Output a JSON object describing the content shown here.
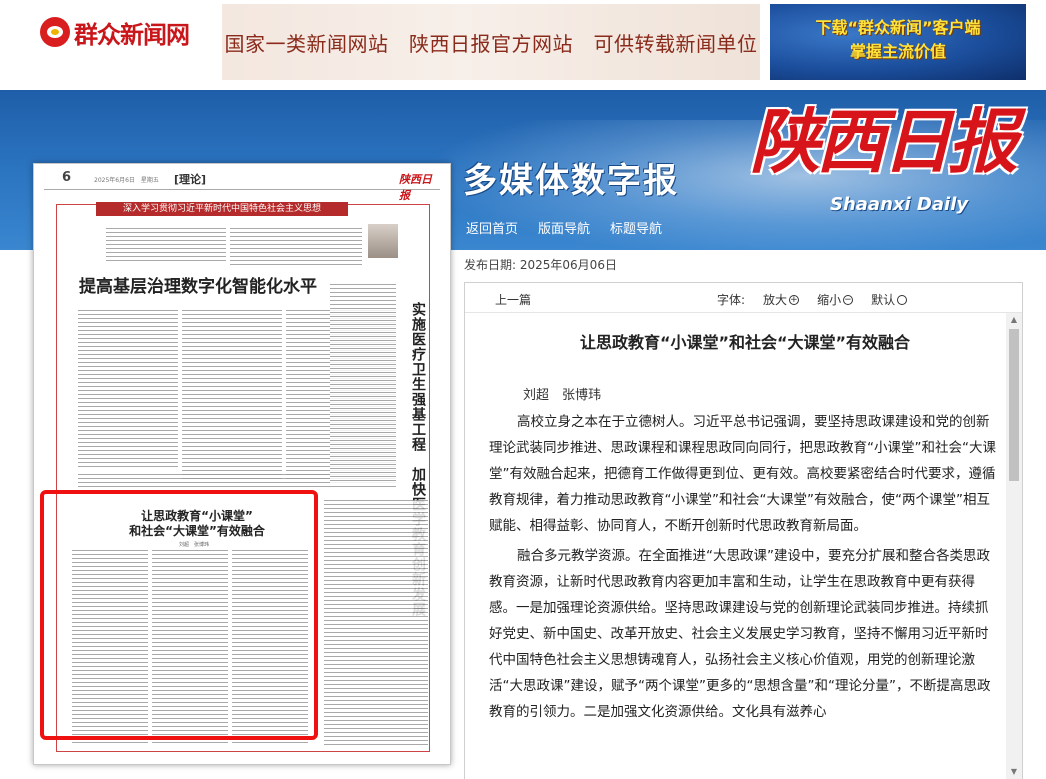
{
  "site": {
    "logo_text": "群众新闻网",
    "banner_mid": "国家一类新闻网站　陕西日报官方网站　可供转载新闻单位",
    "banner_right_line1": "下载“群众新闻”客户端",
    "banner_right_line2": "掌握主流价值"
  },
  "header": {
    "title": "多媒体数字报",
    "brand_cn": "陕西日报",
    "brand_en": "Shaanxi Daily",
    "nav": [
      "返回首页",
      "版面导航",
      "标题导航"
    ]
  },
  "paper_page": {
    "page_number": "6",
    "date": "2025年6月6日　星期五",
    "section": "[理论]",
    "masthead": "陕西日报",
    "red_bar": "深入学习贯彻习近平新时代中国特色社会主义思想",
    "main_title": "提高基层治理数字化智能化水平",
    "vertical_title": "实施医疗卫生强基工程　加快医学教育创新发展",
    "highlight_title_line1": "让思政教育“小课堂”",
    "highlight_title_line2": "和社会“大课堂”有效融合",
    "highlight_authors": "刘超　张博玮"
  },
  "article_panel": {
    "pubdate_label": "发布日期:",
    "pubdate_value": "2025年06月06日",
    "prev_label": "上一篇",
    "font_label": "字体:",
    "zoom_in": "放大",
    "zoom_out": "缩小",
    "default": "默认",
    "title": "让思政教育“小课堂”和社会“大课堂”有效融合",
    "authors": "刘超　张博玮",
    "paragraphs": [
      "高校立身之本在于立德树人。习近平总书记强调，要坚持思政课建设和党的创新理论武装同步推进、思政课程和课程思政同向同行，把思政教育“小课堂”和社会“大课堂”有效融合起来，把德育工作做得更到位、更有效。高校要紧密结合时代要求，遵循教育规律，着力推动思政教育“小课堂”和社会“大课堂”有效融合，使“两个课堂”相互赋能、相得益彰、协同育人，不断开创新时代思政教育新局面。",
      "融合多元教学资源。在全面推进“大思政课”建设中，要充分扩展和整合各类思政教育资源，让新时代思政教育内容更加丰富和生动，让学生在思政教育中更有获得感。一是加强理论资源供给。坚持思政课建设与党的创新理论武装同步推进。持续抓好党史、新中国史、改革开放史、社会主义发展史学习教育，坚持不懈用习近平新时代中国特色社会主义思想铸魂育人，弘扬社会主义核心价值观，用党的创新理论激活“大思政课”建设，赋予“两个课堂”更多的“思想含量”和“理论分量”，不断提高思政教育的引领力。二是加强文化资源供给。文化具有滋养心"
    ]
  }
}
